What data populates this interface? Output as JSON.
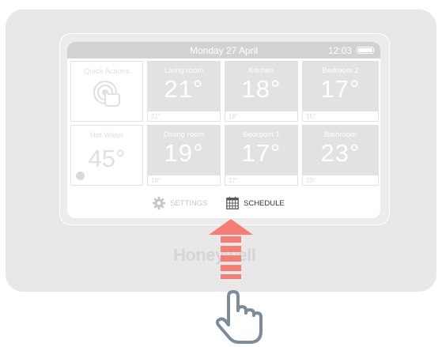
{
  "screen": {
    "date": "Monday 27 April",
    "time": "12:03"
  },
  "tiles": {
    "quick_actions": {
      "label": "Quick Actions"
    },
    "hot_water": {
      "label": "Hot Water",
      "temp": "45°"
    }
  },
  "rooms": [
    {
      "name": "Living room",
      "temp": "21°",
      "setpoint": "21°"
    },
    {
      "name": "Kitchen",
      "temp": "18°",
      "setpoint": "18°"
    },
    {
      "name": "Bedroom 2",
      "temp": "17°",
      "setpoint": "15°"
    },
    {
      "name": "Dining room",
      "temp": "19°",
      "setpoint": "18°"
    },
    {
      "name": "Bedroom 1",
      "temp": "17°",
      "setpoint": "17°"
    },
    {
      "name": "Bathroom",
      "temp": "23°",
      "setpoint": "23°"
    }
  ],
  "nav": {
    "settings_label": "SETTINGS",
    "schedule_label": "SCHEDULE"
  },
  "brand": "Honeywell",
  "colors": {
    "arrow": "#f47e73",
    "hand_outline": "#7d8c99",
    "device": "#e8e8e8",
    "room_tile": "#e2e2e2"
  },
  "icons": [
    "battery-icon",
    "touch-icon",
    "gear-icon",
    "calendar-icon",
    "up-arrow-icon",
    "pointing-hand-icon"
  ]
}
